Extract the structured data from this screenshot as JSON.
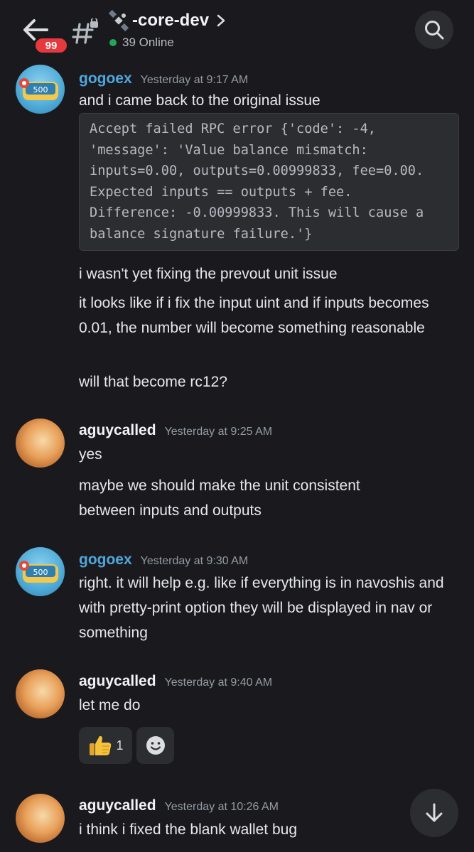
{
  "header": {
    "unread_badge": "99",
    "channel_name": "-core-dev",
    "online_status": "39 Online"
  },
  "messages": [
    {
      "author": "gogoex",
      "timestamp": "Yesterday at 9:17 AM",
      "lines": [
        "and i came back to the original issue"
      ],
      "code": [
        "Accept failed RPC error {'code': -4,",
        "'message': 'Value balance mismatch:",
        "inputs=0.00, outputs=0.00999833, fee=0.00.",
        "Expected inputs == outputs + fee.",
        "Difference: -0.00999833. This will cause a",
        "balance signature failure.'}"
      ],
      "followups": [
        "i wasn't yet fixing the prevout unit issue",
        "it looks like if i fix the input uint and if inputs becomes 0.01, the number will become something reasonable",
        "will that become rc12?"
      ]
    },
    {
      "author": "aguycalled",
      "timestamp": "Yesterday at 9:25 AM",
      "lines": [
        "yes"
      ],
      "followups": [
        "maybe we should make the unit consistent between inputs and outputs"
      ]
    },
    {
      "author": "gogoex",
      "timestamp": "Yesterday at 9:30 AM",
      "lines": [
        "right. it will help e.g. like if everything is in navoshis and with pretty-print option they will be displayed in nav or something"
      ]
    },
    {
      "author": "aguycalled",
      "timestamp": "Yesterday at 9:40 AM",
      "lines": [
        "let me do"
      ],
      "reactions": [
        {
          "emoji": "thumbs-up",
          "count": "1"
        }
      ]
    },
    {
      "author": "aguycalled",
      "timestamp": "Yesterday at 10:26 AM",
      "lines": [
        "i think i fixed the blank wallet bug"
      ]
    }
  ],
  "colors": {
    "background": "#1a1a1e",
    "username_gogoex": "#4ea8de",
    "online_dot": "#23a55a",
    "badge": "#e5393d"
  }
}
